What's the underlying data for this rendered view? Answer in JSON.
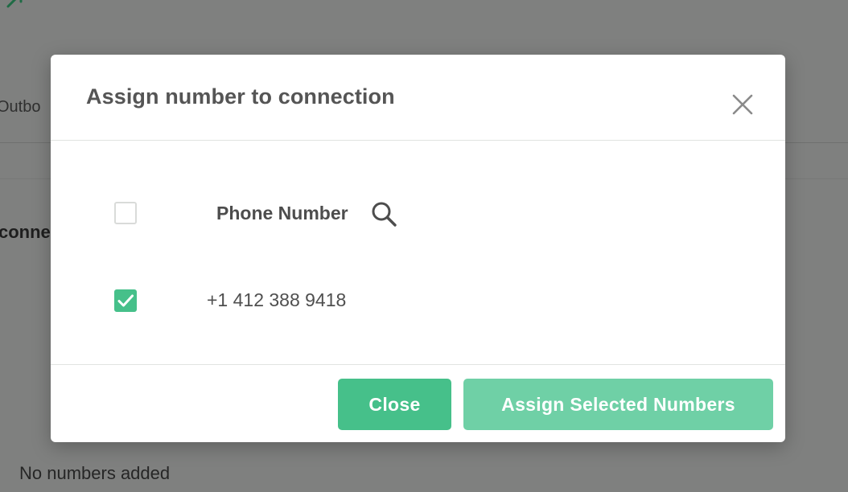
{
  "background": {
    "tab_fragment": "Outbo",
    "heading_fragment": "conne",
    "empty_message": "No numbers added"
  },
  "modal": {
    "title": "Assign number to connection",
    "close_icon": "close-icon",
    "table": {
      "select_all_checked": false,
      "column_header": "Phone Number",
      "search_icon": "search-icon",
      "rows": [
        {
          "checked": true,
          "phone_number": "+1 412 388 9418"
        }
      ]
    },
    "footer": {
      "close_label": "Close",
      "assign_label": "Assign Selected Numbers"
    }
  },
  "colors": {
    "accent": "#46c08a",
    "accent_light": "#6fd0a6",
    "overlay": "#7f807f",
    "text_dark": "#555555"
  }
}
